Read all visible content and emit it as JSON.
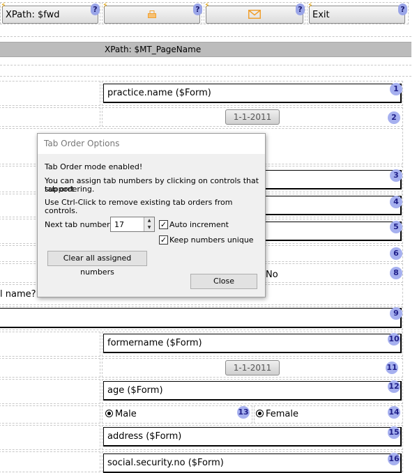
{
  "toolbar": {
    "fwd_label": "XPath: $fwd",
    "exit_label": "Exit",
    "help_glyph": "?",
    "bolt_glyph": "⚡",
    "print_icon": "printer-icon",
    "mail_icon": "envelope-icon",
    "accent_color": "#f0a030"
  },
  "page_name_label": "XPath: $MT_PageName",
  "form": {
    "practice_name": "practice.name ($Form)",
    "date_1": "1-1-2011",
    "no_label": "No",
    "question_fragment": "l name?",
    "formername": "formername ($Form)",
    "date_2": "1-1-2011",
    "age": "age ($Form)",
    "male_label": "Male",
    "female_label": "Female",
    "address": "address ($Form)",
    "social_security": "social.security.no ($Form)"
  },
  "tab_badges": [
    "1",
    "2",
    "3",
    "4",
    "5",
    "6",
    "8",
    "9",
    "10",
    "11",
    "12",
    "13",
    "14",
    "15",
    "16"
  ],
  "dialog": {
    "title": "Tab Order Options",
    "line1": "Tab Order mode enabled!",
    "line2a": "You can assign tab numbers by clicking on controls that support",
    "line2b": "tab ordering.",
    "line3": "Use Ctrl-Click to remove existing tab orders from controls.",
    "next_tab_label": "Next tab number:",
    "next_tab_value": "17",
    "auto_increment_label": "Auto increment",
    "auto_increment_checked": true,
    "keep_unique_label": "Keep numbers unique",
    "keep_unique_checked": true,
    "clear_button": "Clear all assigned numbers",
    "close_button": "Close",
    "check_glyph": "✓"
  }
}
